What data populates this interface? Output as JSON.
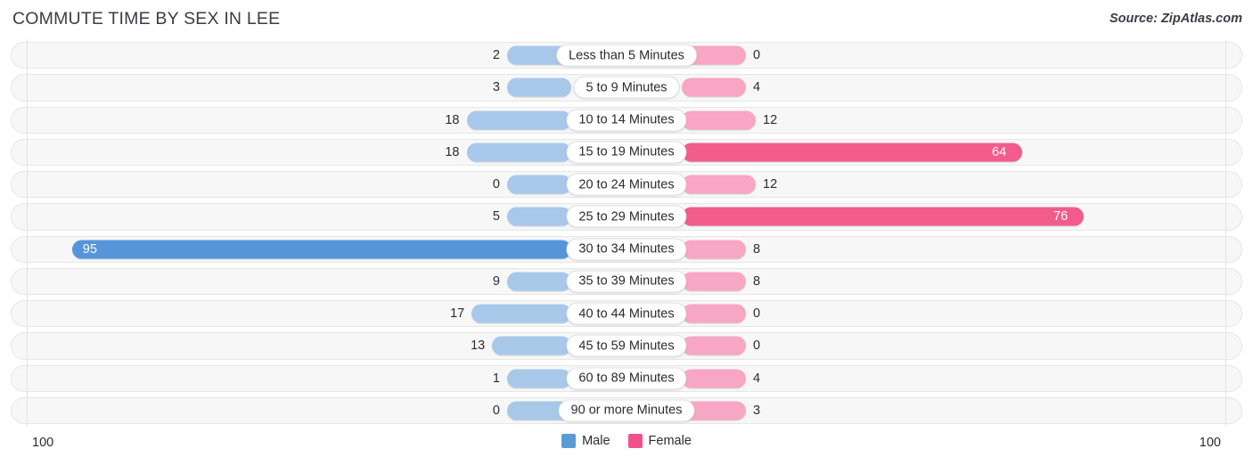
{
  "header": {
    "title": "COMMUTE TIME BY SEX IN LEE",
    "source": "Source: ZipAtlas.com"
  },
  "axis": {
    "left_max_label": "100",
    "right_max_label": "100"
  },
  "legend": {
    "items": [
      {
        "label": "Male",
        "color": "#5b9bd5"
      },
      {
        "label": "Female",
        "color": "#f0518a"
      }
    ]
  },
  "colors": {
    "male_normal": "#a8c8ea",
    "male_highlight": "#5795db",
    "female_normal": "#f7a6c4",
    "female_highlight": "#f25c8d",
    "row_background": "#f7f7f7",
    "row_border": "#e6e6e6",
    "gridline": "#e4e4e4",
    "text": "#2b2b33",
    "title_text": "#3c3c46"
  },
  "chart_data": {
    "type": "bar",
    "title": "COMMUTE TIME BY SEX IN LEE",
    "subtitle": "",
    "orientation": "horizontal-diverging",
    "xlabel": "",
    "ylabel": "",
    "xlim": [
      100,
      100
    ],
    "grid": true,
    "legend_position": "bottom-center",
    "categories": [
      "Less than 5 Minutes",
      "5 to 9 Minutes",
      "10 to 14 Minutes",
      "15 to 19 Minutes",
      "20 to 24 Minutes",
      "25 to 29 Minutes",
      "30 to 34 Minutes",
      "35 to 39 Minutes",
      "40 to 44 Minutes",
      "45 to 59 Minutes",
      "60 to 89 Minutes",
      "90 or more Minutes"
    ],
    "series": [
      {
        "name": "Male",
        "side": "left",
        "values": [
          2,
          3,
          18,
          18,
          0,
          5,
          95,
          9,
          17,
          13,
          1,
          0
        ],
        "highlighted": [
          false,
          false,
          false,
          false,
          false,
          false,
          true,
          false,
          false,
          false,
          false,
          false
        ]
      },
      {
        "name": "Female",
        "side": "right",
        "values": [
          0,
          4,
          12,
          64,
          12,
          76,
          8,
          8,
          0,
          0,
          4,
          3
        ],
        "highlighted": [
          false,
          false,
          false,
          true,
          false,
          true,
          false,
          false,
          false,
          false,
          false,
          false
        ]
      }
    ]
  }
}
